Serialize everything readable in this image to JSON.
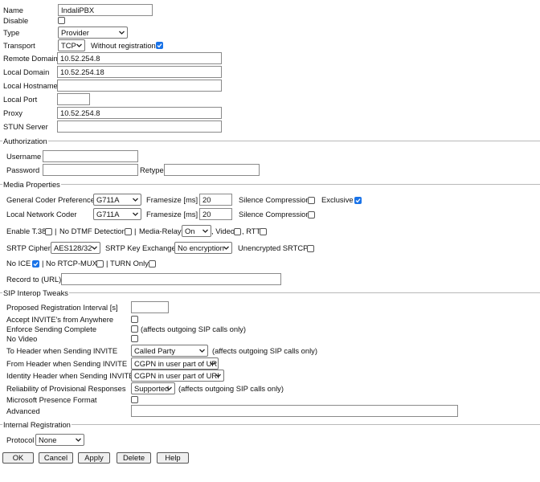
{
  "basic": {
    "name_label": "Name",
    "name_value": "IndaliPBX",
    "disable_label": "Disable",
    "type_label": "Type",
    "type_value": "Provider",
    "transport_label": "Transport",
    "transport_value": "TCP",
    "without_registration_label": "Without registration",
    "remote_domain_label": "Remote Domain",
    "remote_domain_value": "10.52.254.8",
    "local_domain_label": "Local Domain",
    "local_domain_value": "10.52.254.18",
    "local_hostname_label": "Local Hostname",
    "local_hostname_value": "",
    "local_port_label": "Local Port",
    "local_port_value": "",
    "proxy_label": "Proxy",
    "proxy_value": "10.52.254.8",
    "stun_label": "STUN Server",
    "stun_value": ""
  },
  "authorization": {
    "title": "Authorization",
    "username_label": "Username",
    "username_value": "",
    "password_label": "Password",
    "password_value": "",
    "retype_label": "Retype",
    "retype_value": ""
  },
  "media": {
    "title": "Media Properties",
    "general_coder_label": "General Coder Preference",
    "general_coder_value": "G711A",
    "framesize_label": "Framesize [ms]",
    "general_framesize_value": "20",
    "silence_label": "Silence Compression",
    "exclusive_label": "Exclusive",
    "local_coder_label": "Local Network Coder",
    "local_coder_value": "G711A",
    "local_framesize_value": "20",
    "enable_t38_label": "Enable T.38",
    "no_dtmf_label": "No DTMF Detection",
    "media_relay_label": "Media-Relay",
    "media_relay_value": "On",
    "video_label": ", Video",
    "rtt_label": ", RTT",
    "srtp_cipher_label": "SRTP Cipher",
    "srtp_cipher_value": "AES128/32",
    "srtp_key_label": "SRTP Key Exchange",
    "srtp_key_value": "No encryption",
    "unencrypted_srtcp_label": "Unencrypted SRTCP",
    "no_ice_label": "No ICE",
    "no_rtcp_mux_label": "No RTCP-MUX",
    "turn_only_label": "TURN Only",
    "record_label": "Record to (URL)",
    "record_value": ""
  },
  "sip": {
    "title": "SIP Interop Tweaks",
    "proposed_reg_label": "Proposed Registration Interval [s]",
    "proposed_reg_value": "",
    "accept_invite_label": "Accept INVITE's from Anywhere",
    "enforce_label": "Enforce Sending Complete",
    "affects_note": "(affects outgoing SIP calls only)",
    "no_video_label": "No Video",
    "to_header_label": "To Header when Sending INVITE",
    "to_header_value": "Called Party",
    "from_header_label": "From Header when Sending INVITE",
    "from_header_value": "CGPN in user part of URI",
    "identity_header_label": "Identity Header when Sending INVITE",
    "identity_header_value": "CGPN in user part of URI",
    "reliability_label": "Reliability of Provisional Responses",
    "reliability_value": "Supported",
    "ms_presence_label": "Microsoft Presence Format",
    "advanced_label": "Advanced",
    "advanced_value": ""
  },
  "internal": {
    "title": "Internal Registration",
    "protocol_label": "Protocol",
    "protocol_value": "None"
  },
  "buttons": {
    "ok": "OK",
    "cancel": "Cancel",
    "apply": "Apply",
    "delete": "Delete",
    "help": "Help"
  },
  "colors": {
    "check_accent": "#1a73e8",
    "divider": "#b9b9b9"
  }
}
